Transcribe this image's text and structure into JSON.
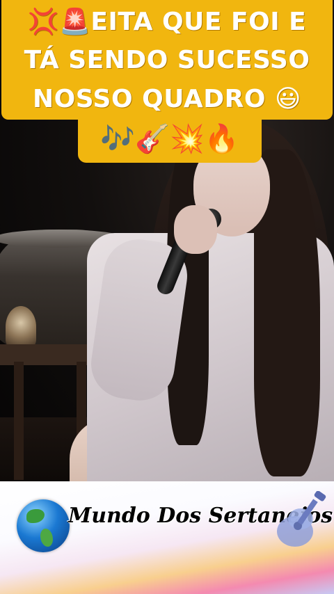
{
  "caption": {
    "line1": "💢🚨EITA QUE FOI E",
    "line2": "TÁ SENDO SUCESSO",
    "line3": "NOSSO QUADRO 😃",
    "emojis": "🎶🎸💥🔥",
    "background_color": "#f1b60f",
    "text_color": "#ffffff"
  },
  "footer": {
    "brand_name": "Mundo Dos Sertanejos",
    "globe_icon": "globe-icon",
    "guitar_icon": "guitar-icon"
  }
}
